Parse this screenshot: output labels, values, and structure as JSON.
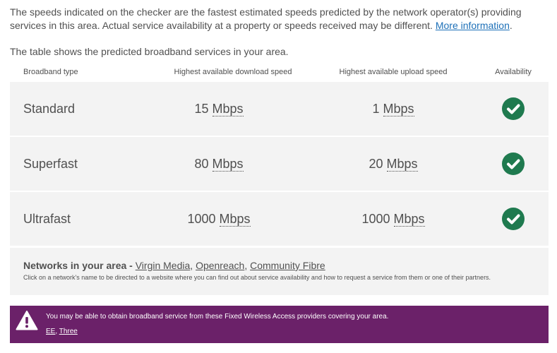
{
  "intro": {
    "text": "The speeds indicated on the checker are the fastest estimated speeds predicted by the network operator(s) providing services in this area. Actual service availability at a property or speeds received may be different.",
    "link": "More information",
    "after_link": "."
  },
  "table_intro": "The table shows the predicted broadband services in your area.",
  "table": {
    "headers": {
      "type": "Broadband type",
      "download": "Highest available download speed",
      "upload": "Highest available upload speed",
      "availability": "Availability"
    },
    "rows": [
      {
        "type": "Standard",
        "download_value": "15",
        "download_unit": "Mbps",
        "upload_value": "1",
        "upload_unit": "Mbps",
        "available": true
      },
      {
        "type": "Superfast",
        "download_value": "80",
        "download_unit": "Mbps",
        "upload_value": "20",
        "upload_unit": "Mbps",
        "available": true
      },
      {
        "type": "Ultrafast",
        "download_value": "1000",
        "download_unit": "Mbps",
        "upload_value": "1000",
        "upload_unit": "Mbps",
        "available": true
      }
    ]
  },
  "networks": {
    "label": "Networks in your area -",
    "links": [
      "Virgin Media",
      "Openreach",
      "Community Fibre"
    ],
    "note": "Click on a network's name to be directed to a website where you can find out about service availability and how to request a service from them or one of their partners."
  },
  "fwa": {
    "message": "You may be able to obtain broadband service from these Fixed Wireless Access providers covering your area.",
    "providers": [
      "EE",
      "Three"
    ]
  },
  "colors": {
    "tick": "#1f7a4f",
    "fwa_background": "#6b2169",
    "row_background": "#f3f3f3",
    "link": "#1d70b8"
  },
  "icons": {
    "availability": "check-circle-icon",
    "warning": "warning-triangle-icon"
  }
}
